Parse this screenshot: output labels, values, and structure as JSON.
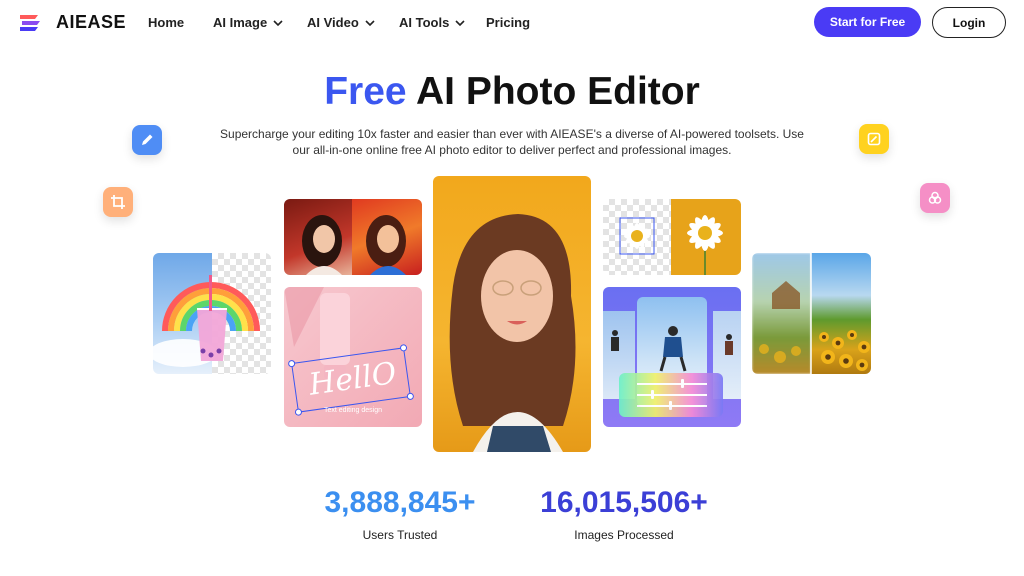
{
  "brand": {
    "name": "AIEASE"
  },
  "nav": {
    "items": [
      {
        "label": "Home",
        "has_dropdown": false
      },
      {
        "label": "AI Image",
        "has_dropdown": true
      },
      {
        "label": "AI Video",
        "has_dropdown": true
      },
      {
        "label": "AI Tools",
        "has_dropdown": true
      },
      {
        "label": "Pricing",
        "has_dropdown": false
      }
    ],
    "start_label": "Start for Free",
    "login_label": "Login"
  },
  "hero": {
    "title_accent": "Free",
    "title_rest": " AI Photo Editor",
    "subtitle": "Supercharge your editing 10x faster and easier than ever with AIEASE's a diverse of AI-powered toolsets. Use our all-in-one online free AI photo editor to deliver perfect and professional images."
  },
  "cards": {
    "text_edit_script": "HellO",
    "text_edit_caption": "Text editing design"
  },
  "stats": [
    {
      "value": "3,888,845+",
      "label": "Users Trusted",
      "color": "#3b8ff0"
    },
    {
      "value": "16,015,506+",
      "label": "Images Processed",
      "color": "#3b3fd6"
    }
  ],
  "colors": {
    "accent": "#3b57f0",
    "primary_button": "#4a3bf5"
  },
  "icons": {
    "float_left_top": "pencil-icon",
    "float_left_bottom": "crop-icon",
    "float_right_top": "image-edit-icon",
    "float_right_bottom": "layers-icon"
  }
}
